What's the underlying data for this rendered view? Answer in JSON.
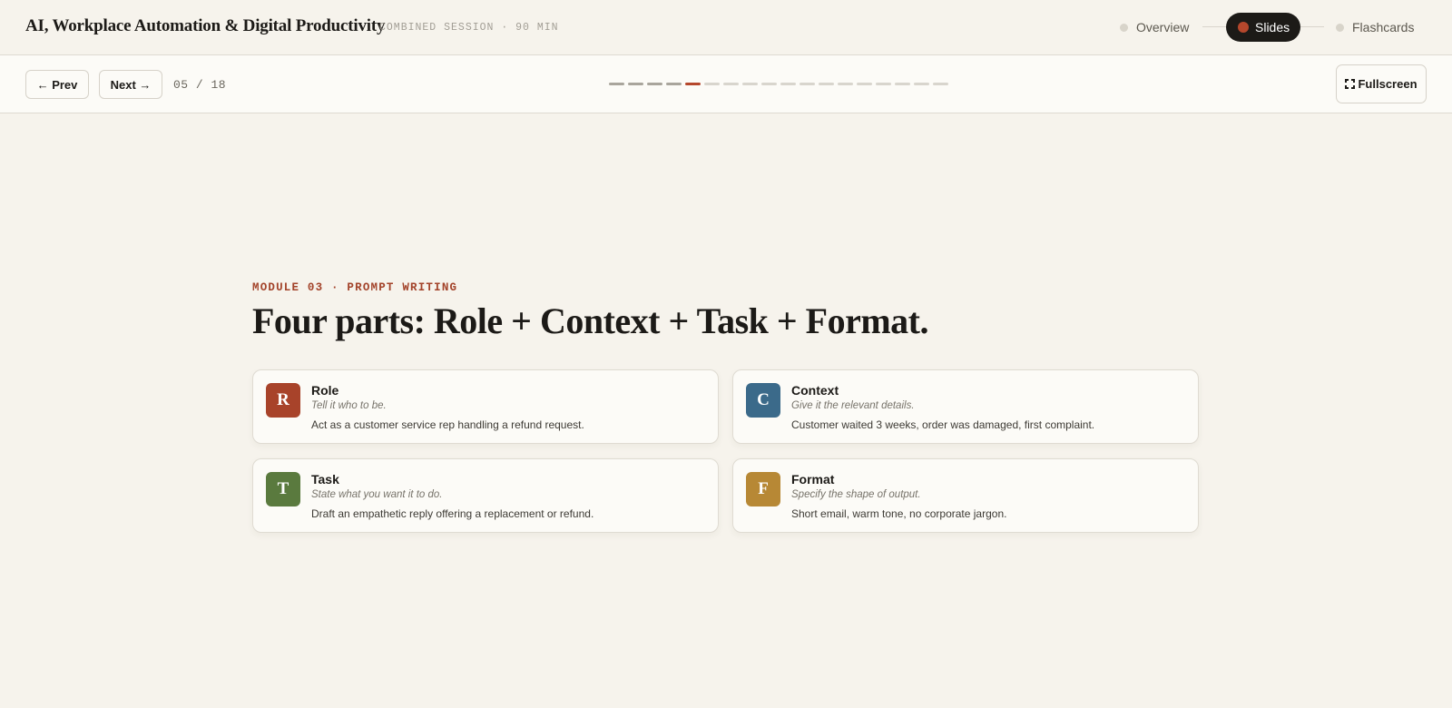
{
  "header": {
    "title": "AI, Workplace Automation & Digital Productivity",
    "meta": "COMBINED SESSION · 90 MIN",
    "steps": [
      {
        "label": "Overview",
        "active": false
      },
      {
        "label": "Slides",
        "active": true
      },
      {
        "label": "Flashcards",
        "active": false
      }
    ]
  },
  "toolbar": {
    "prev_label": "← Prev",
    "next_label": "Next →",
    "counter": "05 / 18",
    "current_slide": 5,
    "total_slides": 18,
    "fullscreen_label": "Fullscreen"
  },
  "slide": {
    "eyebrow": "MODULE 03 · PROMPT WRITING",
    "title": "Four parts: Role + Context + Task + Format.",
    "cards": [
      {
        "letter": "R",
        "name": "Role",
        "hint": "Tell it who to be.",
        "description": "Act as a customer service rep handling a refund request.",
        "color": "#a8432a"
      },
      {
        "letter": "C",
        "name": "Context",
        "hint": "Give it the relevant details.",
        "description": "Customer waited 3 weeks, order was damaged, first complaint.",
        "color": "#3b6a8a"
      },
      {
        "letter": "T",
        "name": "Task",
        "hint": "State what you want it to do.",
        "description": "Draft an empathetic reply offering a replacement or refund.",
        "color": "#5a7a3e"
      },
      {
        "letter": "F",
        "name": "Format",
        "hint": "Specify the shape of output.",
        "description": "Short email, warm tone, no corporate jargon.",
        "color": "#b78835"
      }
    ]
  },
  "colors": {
    "accent": "#b5472c",
    "background": "#f6f3ec",
    "dark": "#1c1a17"
  }
}
